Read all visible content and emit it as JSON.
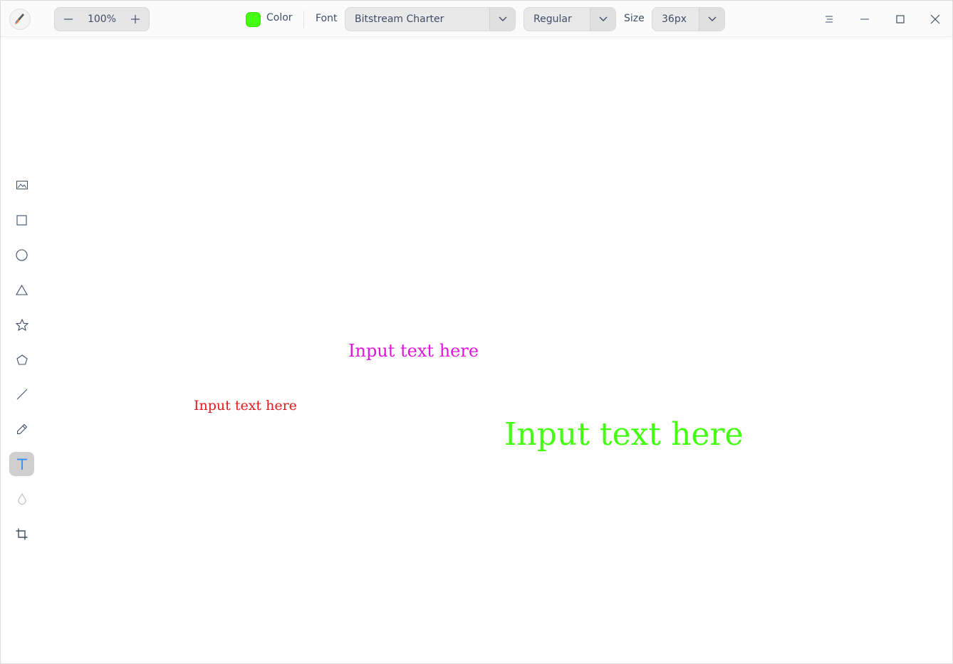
{
  "toolbar": {
    "zoom": {
      "decrease_icon": "minus-icon",
      "value": "100%",
      "increase_icon": "plus-icon"
    },
    "color": {
      "swatch": "#44ff11",
      "label": "Color"
    },
    "font": {
      "label": "Font",
      "family": "Bitstream Charter",
      "weight": "Regular"
    },
    "size": {
      "label": "Size",
      "value": "36px"
    }
  },
  "window_controls": [
    "menu-icon",
    "minimize-icon",
    "maximize-icon",
    "close-icon"
  ],
  "tools": [
    {
      "name": "image",
      "icon": "image-icon",
      "active": false
    },
    {
      "name": "rectangle",
      "icon": "rectangle-icon",
      "active": false
    },
    {
      "name": "ellipse",
      "icon": "ellipse-icon",
      "active": false
    },
    {
      "name": "triangle",
      "icon": "triangle-icon",
      "active": false
    },
    {
      "name": "star",
      "icon": "star-icon",
      "active": false
    },
    {
      "name": "polygon",
      "icon": "pentagon-icon",
      "active": false
    },
    {
      "name": "line",
      "icon": "line-icon",
      "active": false
    },
    {
      "name": "pencil",
      "icon": "pencil-icon",
      "active": false
    },
    {
      "name": "text",
      "icon": "text-icon",
      "active": true
    },
    {
      "name": "blur",
      "icon": "blur-drop-icon",
      "active": false
    },
    {
      "name": "crop",
      "icon": "crop-icon",
      "active": false
    }
  ],
  "canvas": {
    "texts": [
      {
        "text": "Input text here",
        "color": "#e014e0"
      },
      {
        "text": "Input text here",
        "color": "#dd1b1b"
      },
      {
        "text": "Input text here",
        "color": "#44ff11"
      }
    ]
  },
  "colors": {
    "accent": "#2c8bff",
    "active_tool_bg": "#cfcfcf"
  }
}
